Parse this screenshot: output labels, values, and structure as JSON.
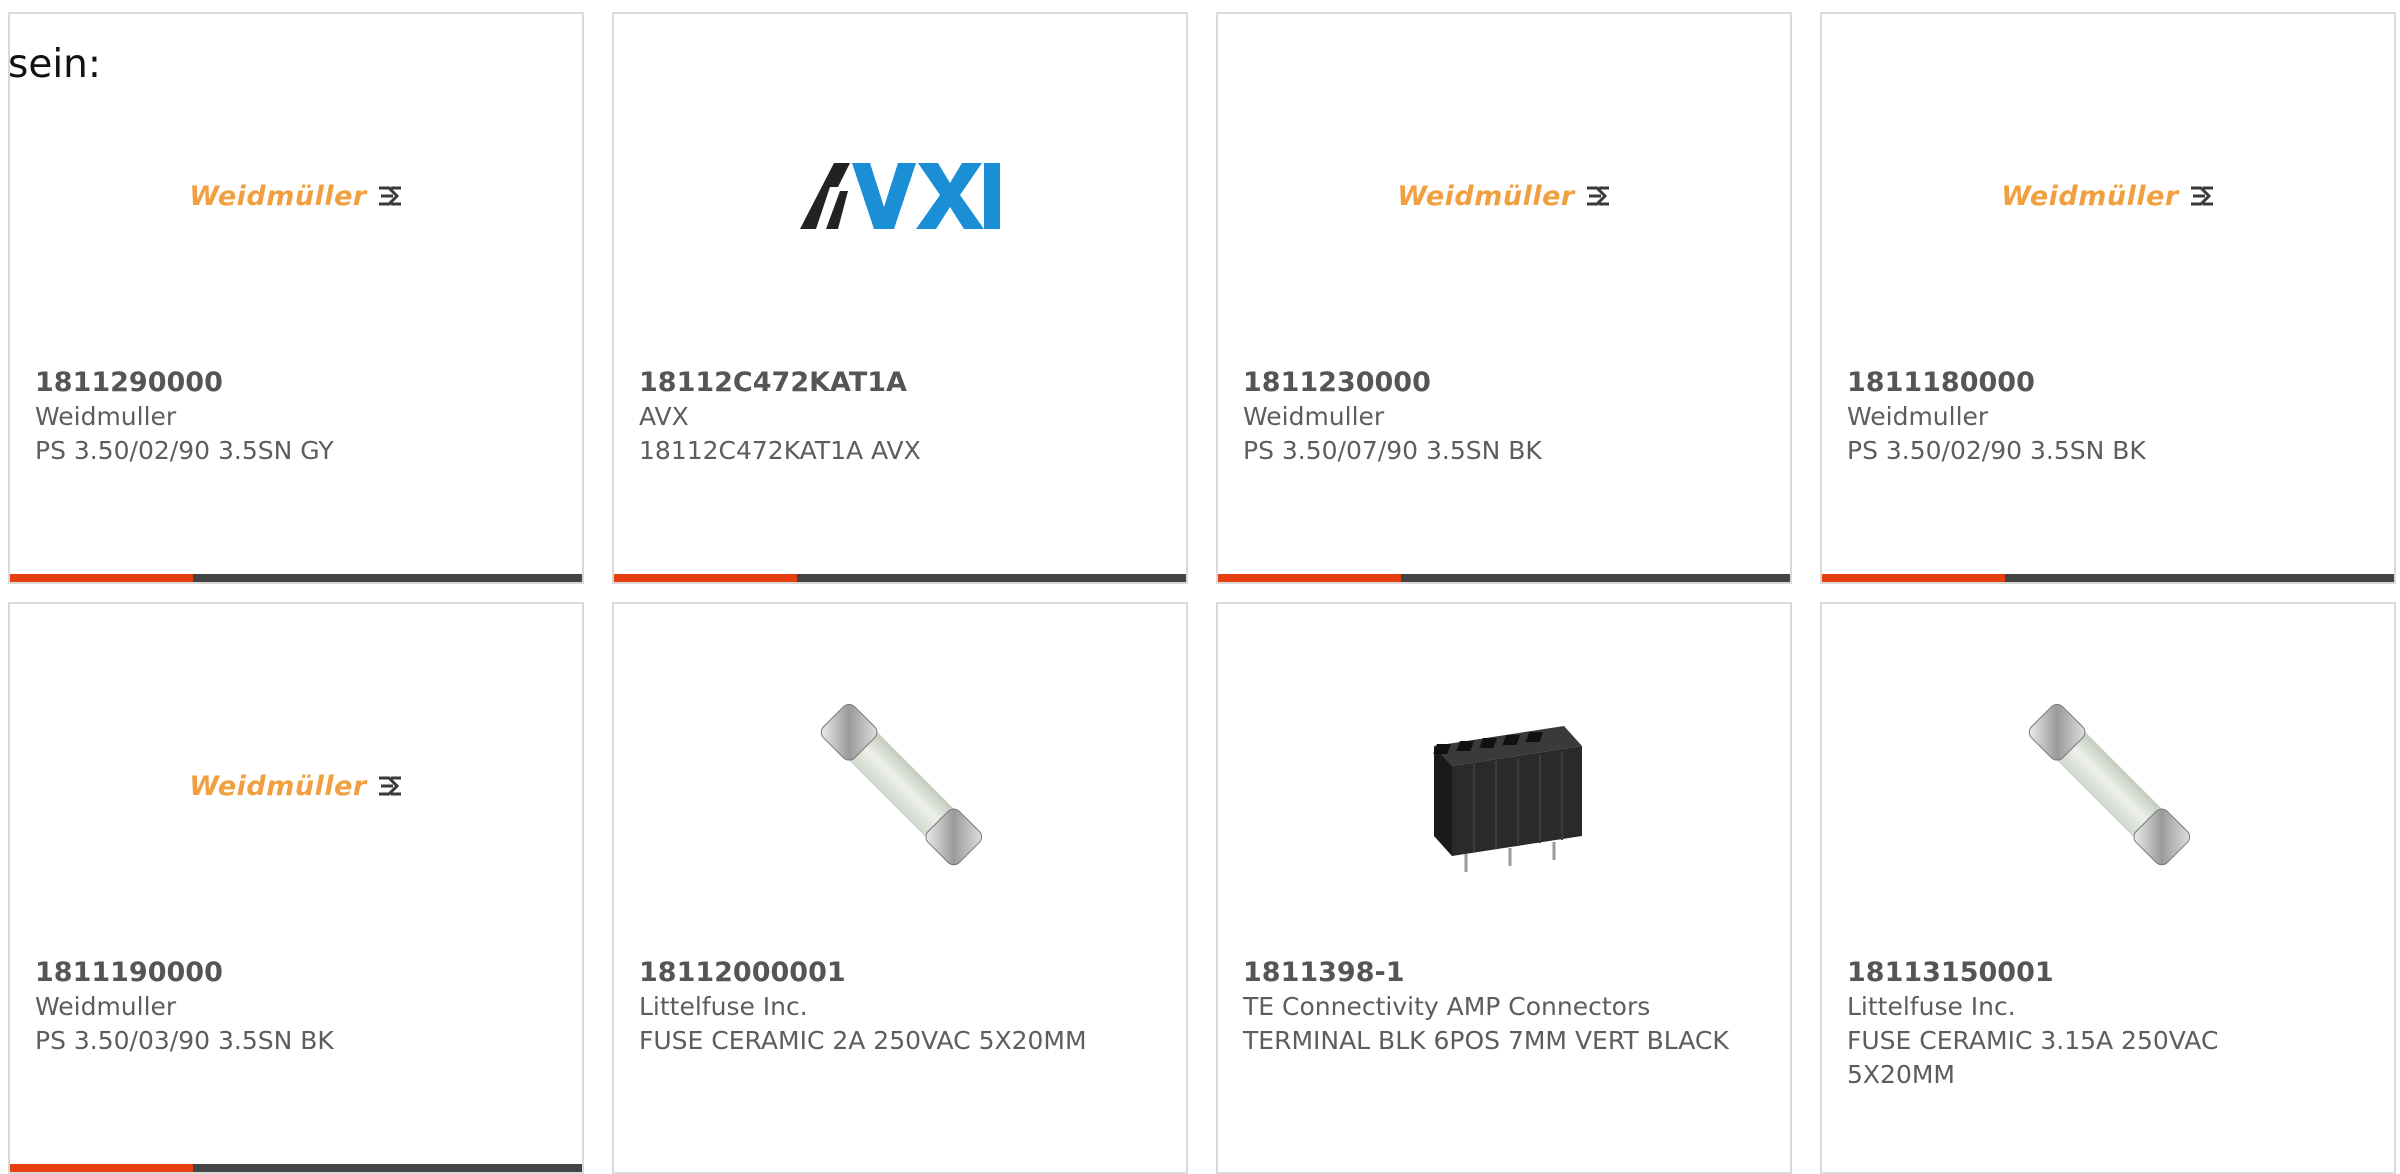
{
  "intro_text": "sein:",
  "colors": {
    "bar_accent": "#e63f10",
    "bar_base": "#444444",
    "weidmuller_orange": "#f0a040",
    "avx_blue": "#1a8fd6"
  },
  "cards": [
    {
      "part_number": "1811290000",
      "manufacturer": "Weidmuller",
      "description": "PS 3.50/02/90 3.5SN GY",
      "image": "weidmuller-logo",
      "logo_text": "Weidmüller"
    },
    {
      "part_number": "18112C472KAT1A",
      "manufacturer": "AVX",
      "description": "18112C472KAT1A AVX",
      "image": "avx-logo",
      "logo_text": "AVX"
    },
    {
      "part_number": "1811230000",
      "manufacturer": "Weidmuller",
      "description": "PS 3.50/07/90 3.5SN BK",
      "image": "weidmuller-logo",
      "logo_text": "Weidmüller"
    },
    {
      "part_number": "1811180000",
      "manufacturer": "Weidmuller",
      "description": "PS 3.50/02/90 3.5SN BK",
      "image": "weidmuller-logo",
      "logo_text": "Weidmüller"
    },
    {
      "part_number": "1811190000",
      "manufacturer": "Weidmuller",
      "description": "PS 3.50/03/90 3.5SN BK",
      "image": "weidmuller-logo",
      "logo_text": "Weidmüller"
    },
    {
      "part_number": "18112000001",
      "manufacturer": "Littelfuse Inc.",
      "description": "FUSE CERAMIC 2A 250VAC 5X20MM",
      "image": "ceramic-fuse-photo"
    },
    {
      "part_number": "1811398-1",
      "manufacturer": "TE Connectivity AMP Connectors",
      "description": "TERMINAL BLK 6POS 7MM VERT BLACK",
      "image": "terminal-block-photo"
    },
    {
      "part_number": "18113150001",
      "manufacturer": "Littelfuse Inc.",
      "description": "FUSE CERAMIC 3.15A 250VAC 5X20MM",
      "image": "ceramic-fuse-photo"
    }
  ]
}
